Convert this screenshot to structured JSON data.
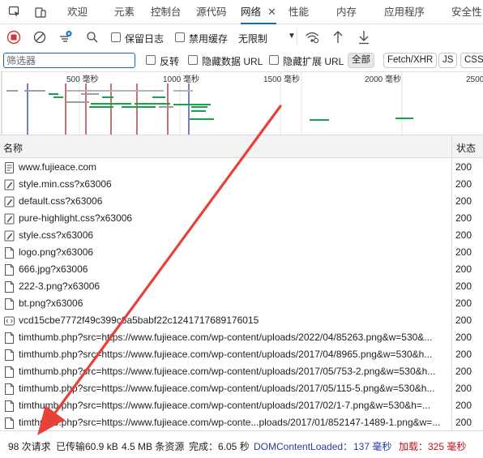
{
  "tabs": [
    {
      "label": "欢迎"
    },
    {
      "label": "元素"
    },
    {
      "label": "控制台"
    },
    {
      "label": "源代码"
    },
    {
      "label": "网络"
    },
    {
      "label": "性能"
    },
    {
      "label": "内存"
    },
    {
      "label": "应用程序"
    },
    {
      "label": "安全性"
    }
  ],
  "toolbar": {
    "preserve_log": "保留日志",
    "disable_cache": "禁用缓存",
    "throttling": "无限制"
  },
  "filter": {
    "placeholder": "筛选器",
    "invert": "反转",
    "hide_data_urls": "隐藏数据 URL",
    "hide_extension_urls": "隐藏扩展 URL",
    "types": [
      "全部",
      "Fetch/XHR",
      "JS",
      "CSS"
    ]
  },
  "overview": {
    "ticks": [
      "500 毫秒",
      "1000 毫秒",
      "1500 毫秒",
      "2000 毫秒",
      "2500"
    ]
  },
  "table": {
    "col_name": "名称",
    "col_status": "状态",
    "rows": [
      {
        "name": "www.fujieace.com",
        "status": "200",
        "icon": "document-icon"
      },
      {
        "name": "style.min.css?x63006",
        "status": "200",
        "icon": "stylesheet-icon"
      },
      {
        "name": "default.css?x63006",
        "status": "200",
        "icon": "stylesheet-icon"
      },
      {
        "name": "pure-highlight.css?x63006",
        "status": "200",
        "icon": "stylesheet-icon"
      },
      {
        "name": "style.css?x63006",
        "status": "200",
        "icon": "stylesheet-icon"
      },
      {
        "name": "logo.png?x63006",
        "status": "200",
        "icon": "image-file-icon"
      },
      {
        "name": "666.jpg?x63006",
        "status": "200",
        "icon": "image-file-icon"
      },
      {
        "name": "222-3.png?x63006",
        "status": "200",
        "icon": "image-file-icon"
      },
      {
        "name": "bt.png?x63006",
        "status": "200",
        "icon": "image-file-icon"
      },
      {
        "name": "vcd15cbe7772f49c399c6a5babf22c1241717689176015",
        "status": "200",
        "icon": "script-icon"
      },
      {
        "name": "timthumb.php?src=https://www.fujieace.com/wp-content/uploads/2022/04/85263.png&w=530&...",
        "status": "200",
        "icon": "image-file-icon"
      },
      {
        "name": "timthumb.php?src=https://www.fujieace.com/wp-content/uploads/2017/04/8965.png&w=530&h...",
        "status": "200",
        "icon": "image-file-icon"
      },
      {
        "name": "timthumb.php?src=https://www.fujieace.com/wp-content/uploads/2017/05/753-2.png&w=530&h...",
        "status": "200",
        "icon": "image-file-icon"
      },
      {
        "name": "timthumb.php?src=https://www.fujieace.com/wp-content/uploads/2017/05/115-5.png&w=530&h...",
        "status": "200",
        "icon": "image-file-icon"
      },
      {
        "name": "timthumb.php?src=https://www.fujieace.com/wp-content/uploads/2017/02/1-7.png&w=530&h=...",
        "status": "200",
        "icon": "image-file-icon"
      },
      {
        "name": "timthumb.php?src=https://www.fujieace.com/wp-conte...ploads/2017/01/852147-1489-1.png&w=...",
        "status": "200",
        "icon": "image-file-icon"
      }
    ]
  },
  "statusbar": {
    "requests": "98 次请求",
    "transferred": "已传输60.9 kB",
    "resources": "4.5 MB 条资源",
    "finish": "完成：6.05 秒",
    "dcl_label": "DOMContentLoaded：",
    "dcl_value": "137 毫秒",
    "load_label": "加载：",
    "load_value": "325 毫秒"
  },
  "colors": {
    "accent": "#0f6cbd",
    "record": "#d13438",
    "dcl": "#2b3aa5",
    "load": "#c50f1f",
    "waterfall_green": "#16a34a",
    "arrow": "#e8413a"
  }
}
